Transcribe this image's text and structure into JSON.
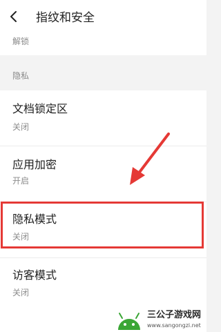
{
  "header": {
    "back_icon": "chevron-left-icon",
    "title": "指纹和安全"
  },
  "previous_item": {
    "subtitle": "解锁"
  },
  "section": {
    "label": "隐私"
  },
  "items": [
    {
      "title": "文档锁定区",
      "status": "关闭"
    },
    {
      "title": "应用加密",
      "status": "开启"
    },
    {
      "title": "隐私模式",
      "status": "关闭"
    },
    {
      "title": "访客模式",
      "status": "关闭"
    }
  ],
  "annotation": {
    "highlight_color": "#e53935",
    "arrow_color": "#e53935"
  },
  "watermark": {
    "title": "三公子游戏网",
    "url": "www.sangongzi.net"
  }
}
